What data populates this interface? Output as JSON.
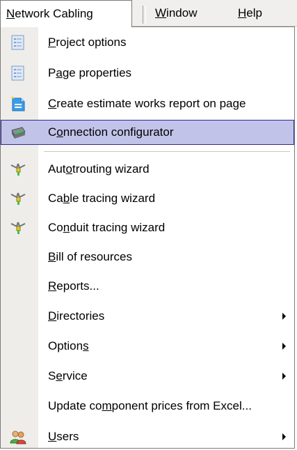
{
  "menubar": {
    "network_cabling": "Network Cabling",
    "window": "Window",
    "help": "Help"
  },
  "menu": {
    "items": [
      {
        "label": "Project options",
        "icon": "list-document-icon"
      },
      {
        "label": "Page properties",
        "icon": "list-document-icon"
      },
      {
        "label": "Create estimate works report on page",
        "icon": "new-report-icon"
      },
      {
        "label": "Connection configurator",
        "icon": "connector-icon",
        "highlighted": true
      },
      {
        "label": "Autotrouting wizard",
        "icon": "wizard-icon"
      },
      {
        "label": "Cable tracing wizard",
        "icon": "wizard-icon"
      },
      {
        "label": "Conduit tracing wizard",
        "icon": "wizard-icon"
      },
      {
        "label": "Bill of resources"
      },
      {
        "label": "Reports..."
      },
      {
        "label": "Directories",
        "submenu": true
      },
      {
        "label": "Options",
        "submenu": true
      },
      {
        "label": "Service",
        "submenu": true
      },
      {
        "label": "Update component prices from Excel..."
      },
      {
        "label": "Users",
        "icon": "users-icon",
        "submenu": true
      }
    ]
  },
  "colors": {
    "highlight_fill": "#c2c3e9",
    "highlight_border": "#2f2b8a",
    "icon_strip": "#eeede9"
  }
}
